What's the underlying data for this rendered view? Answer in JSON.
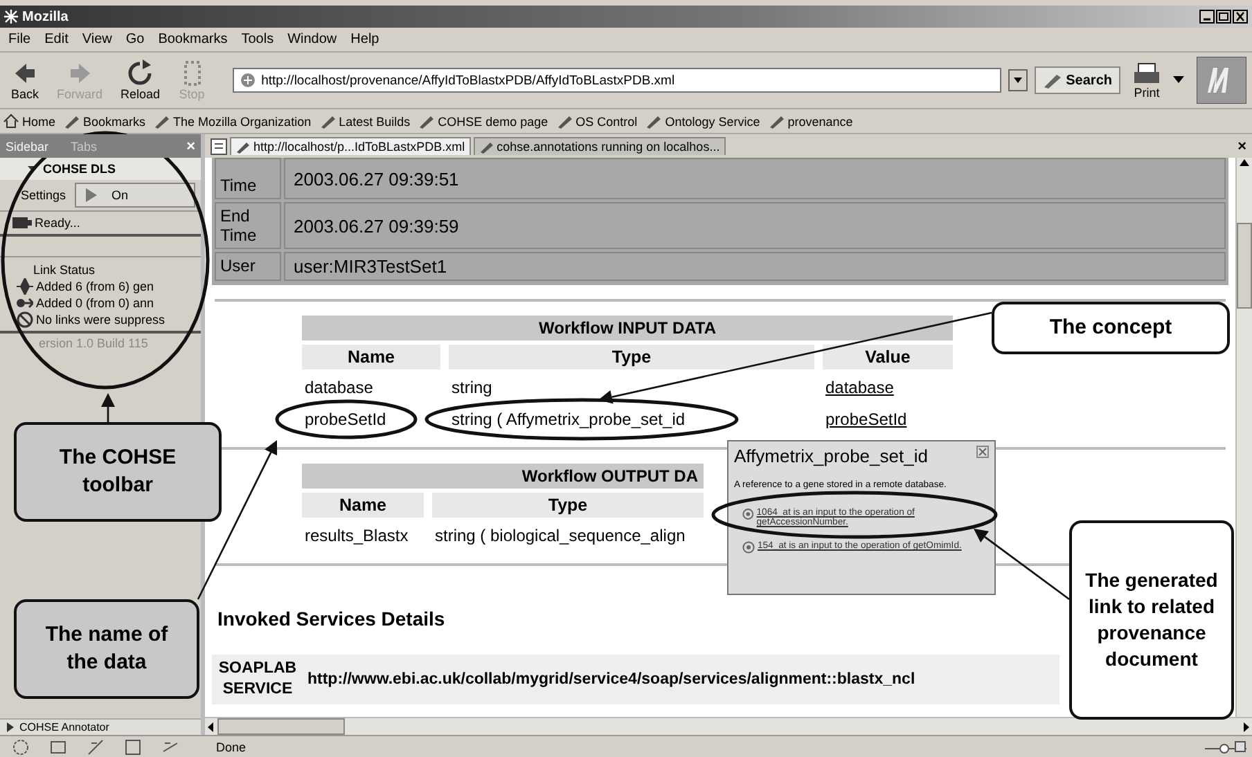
{
  "window": {
    "title": "Mozilla"
  },
  "menu": [
    "File",
    "Edit",
    "View",
    "Go",
    "Bookmarks",
    "Tools",
    "Window",
    "Help"
  ],
  "nav_toolbar": {
    "buttons": [
      {
        "kind": "back",
        "label": "Back",
        "disabled": false
      },
      {
        "kind": "forward",
        "label": "Forward",
        "disabled": true
      },
      {
        "kind": "reload",
        "label": "Reload",
        "disabled": false
      },
      {
        "kind": "stop",
        "label": "Stop",
        "disabled": true
      }
    ],
    "url": "http://localhost/provenance/AffyIdToBlastxPDB/AffyIdToBLastxPDB.xml",
    "search": "Search",
    "print": "Print"
  },
  "bookmarks_bar": [
    "Home",
    "Bookmarks",
    "The Mozilla Organization",
    "Latest Builds",
    "COHSE demo page",
    "OS Control",
    "Ontology Service",
    "provenance"
  ],
  "sidebar": {
    "tabs": [
      {
        "label": "Sidebar",
        "selected": true
      },
      {
        "label": "Tabs",
        "selected": false
      }
    ],
    "panel_title": "COHSE DLS",
    "settings": "Settings",
    "toggle": {
      "label": "On",
      "on": true
    },
    "status": "Ready...",
    "link_status": {
      "title": "Link Status",
      "lines": [
        {
          "kind": "generic",
          "text": "Added 6 (from 6) gen"
        },
        {
          "kind": "annotation",
          "text": "Added 0 (from 0) ann"
        },
        {
          "kind": "suppressed",
          "text": "No links were suppress"
        }
      ]
    },
    "close": "×",
    "version": "ersion 1.0 Build 115",
    "footer": "COHSE Annotator"
  },
  "tab_close": "×",
  "tabs": [
    {
      "label": "http://localhost/p...IdToBLastxPDB.xml",
      "selected": true
    },
    {
      "label": "cohse.annotations running on localhos...",
      "selected": false
    }
  ],
  "run_info": [
    {
      "label": "Time",
      "value": "2003.06.27 09:39:51"
    },
    {
      "label": "End Time",
      "value": "2003.06.27 09:39:59"
    },
    {
      "label": "User",
      "value": "user:MIR3TestSet1"
    }
  ],
  "input_table": {
    "title": "Workflow INPUT DATA",
    "columns": [
      "Name",
      "Type",
      "Value"
    ],
    "rows": [
      {
        "name": "database",
        "type": "string",
        "value": "database"
      },
      {
        "name": "probeSetId",
        "type": "string ( Affymetrix_probe_set_id",
        "value": "probeSetId"
      }
    ]
  },
  "output_table": {
    "title": "Workflow OUTPUT DA",
    "columns": [
      "Name",
      "Type"
    ],
    "rows": [
      {
        "name": "results_Blastx",
        "type": "string ( biological_sequence_align"
      }
    ]
  },
  "services": {
    "heading": "Invoked Services Details",
    "rows": [
      {
        "label": "SOAPLAB SERVICE",
        "value": "http://www.ebi.ac.uk/collab/mygrid/service4/soap/services/alignment::blastx_ncl"
      }
    ]
  },
  "popup": {
    "title": "Affymetrix_probe_set_id",
    "description": "A reference to a gene stored in a remote database.",
    "links": [
      "1064_at is an input to the operation of getAccessionNumber.",
      "154_at is an input to the operation of getOmimId."
    ]
  },
  "status_bar": {
    "text": "Done"
  },
  "callouts": [
    {
      "kind": "concept",
      "text": "The concept"
    },
    {
      "kind": "toolbar",
      "text": "The COHSE toolbar"
    },
    {
      "kind": "name",
      "text": "The name of the data"
    },
    {
      "kind": "link",
      "text": "The generated link to related provenance document"
    }
  ]
}
